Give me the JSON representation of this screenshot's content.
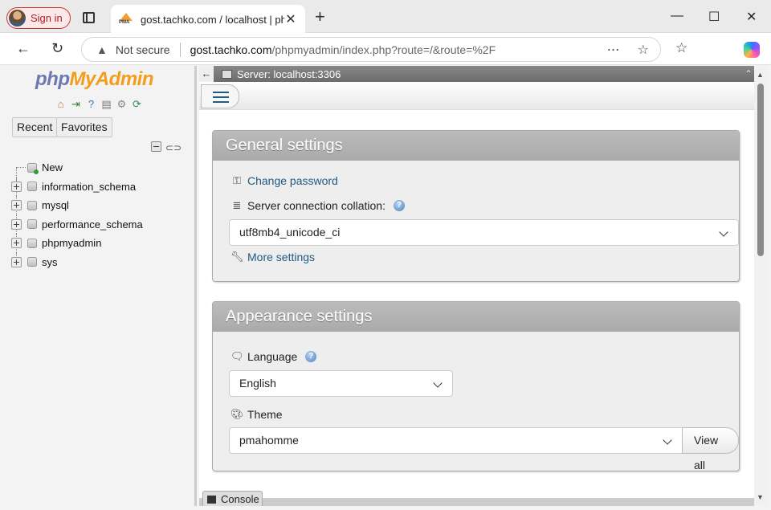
{
  "browser": {
    "signin_label": "Sign in",
    "tab_title": "gost.tachko.com / localhost | php",
    "tab_close": "✕",
    "new_tab": "+",
    "not_secure": "Not secure",
    "url_host": "gost.tachko.com",
    "url_path": "/phpmyadmin/index.php?route=/&route=%2F",
    "minimize": "—",
    "maximize": "☐",
    "close": "✕"
  },
  "sidebar": {
    "logo_php": "php",
    "logo_myadmin": "MyAdmin",
    "recent_label": "Recent",
    "favorites_label": "Favorites",
    "tree": [
      {
        "label": "New",
        "icon": "new-database-icon"
      },
      {
        "label": "information_schema",
        "icon": "database-icon"
      },
      {
        "label": "mysql",
        "icon": "database-icon"
      },
      {
        "label": "performance_schema",
        "icon": "database-icon"
      },
      {
        "label": "phpmyadmin",
        "icon": "database-icon"
      },
      {
        "label": "sys",
        "icon": "database-icon"
      }
    ]
  },
  "header": {
    "server_label": "Server: localhost:3306"
  },
  "general": {
    "title": "General settings",
    "change_password": "Change password",
    "collation_label": "Server connection collation:",
    "collation_value": "utf8mb4_unicode_ci",
    "more_settings": "More settings"
  },
  "appearance": {
    "title": "Appearance settings",
    "language_label": "Language",
    "language_value": "English",
    "theme_label": "Theme",
    "theme_value": "pmahomme",
    "view_all": "View all"
  },
  "console": {
    "label": "Console"
  },
  "colors": {
    "accent_link": "#235a81",
    "logo_blue": "#6c78af",
    "logo_orange": "#f29d1c",
    "fieldset_header": "#aaaaaa"
  }
}
